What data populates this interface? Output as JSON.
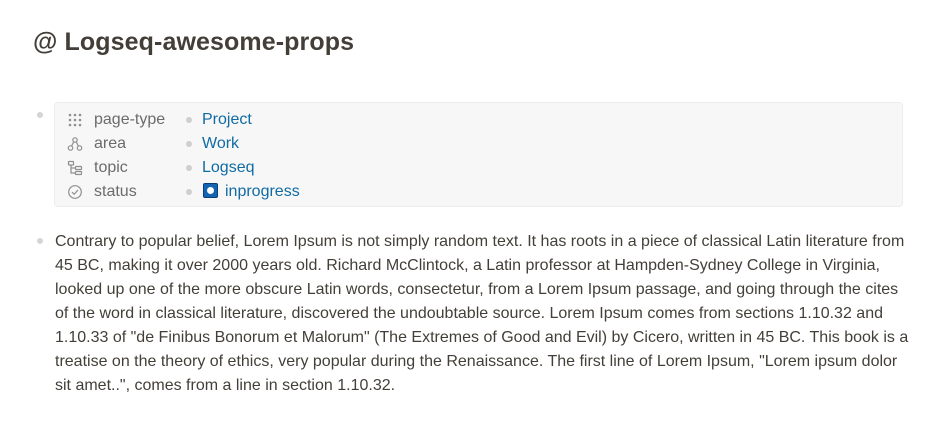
{
  "page": {
    "title": "@ Logseq-awesome-props"
  },
  "properties": [
    {
      "icon": "grid-dots-icon",
      "key": "page-type",
      "value": "Project"
    },
    {
      "icon": "hierarchy-icon",
      "key": "area",
      "value": "Work"
    },
    {
      "icon": "subtask-icon",
      "key": "topic",
      "value": "Logseq"
    },
    {
      "icon": "circle-check-icon",
      "key": "status",
      "value": "inprogress"
    }
  ],
  "status_icon_color": "#1364b3",
  "link_color": "#106ba3",
  "paragraph": "Contrary to popular belief, Lorem Ipsum is not simply random text. It has roots in a piece of classical Latin literature from 45 BC, making it over 2000 years old. Richard McClintock, a Latin professor at Hampden-Sydney College in Virginia, looked up one of the more obscure Latin words, consectetur, from a Lorem Ipsum passage, and going through the cites of the word in classical literature, discovered the undoubtable source. Lorem Ipsum comes from sections 1.10.32 and 1.10.33 of \"de Finibus Bonorum et Malorum\" (The Extremes of Good and Evil) by Cicero, written in 45 BC. This book is a treatise on the theory of ethics, very popular during the Renaissance. The first line of Lorem Ipsum, \"Lorem ipsum dolor sit amet..\", comes from a line in section 1.10.32."
}
